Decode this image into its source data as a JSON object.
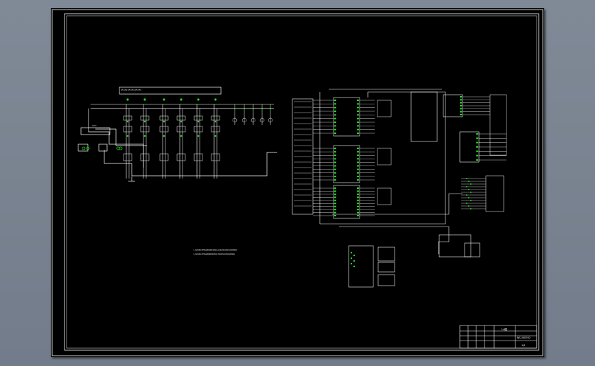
{
  "viewer": {
    "background": "#7d8795",
    "sheet_background": "#000000"
  },
  "drawing": {
    "line_color": "#ffffff",
    "accent_color": "#22dd22",
    "notes": [
      "1.CVS23D RFMS22B-DN15M4Q+CVS23D-DN15 DN15M4Q",
      "2.CVS23D RFMS22B/RPMCMCO 2MCMPUCCHDN15M4Q"
    ],
    "title_block": {
      "drawing_title": "1-6图",
      "drawing_number": "WS-000700",
      "sheet": "1/2"
    }
  }
}
